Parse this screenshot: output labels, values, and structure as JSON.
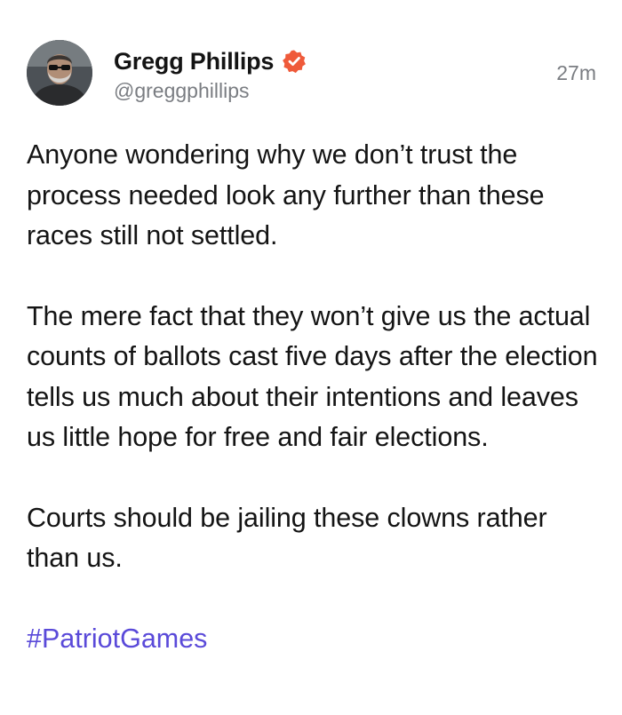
{
  "author": {
    "display_name": "Gregg Phillips",
    "handle": "@greggphillips",
    "verified_icon": "verified-badge-icon",
    "avatar": "avatar-photo"
  },
  "post": {
    "time_ago": "27m",
    "paragraphs": [
      "Anyone wondering why we don’t trust the process needed look any further than these races still not settled.",
      "The mere fact that they won’t give us the actual counts of ballots cast five days after the election tells us much about their intentions and leaves us little hope for free and fair elections.",
      "Courts should be jailing these clowns rather than us."
    ],
    "hashtag": "#PatriotGames"
  },
  "colors": {
    "text": "#141414",
    "muted": "#7a7d82",
    "hashtag": "#5a4ad9",
    "verified_badge": "#ef5a3a"
  }
}
